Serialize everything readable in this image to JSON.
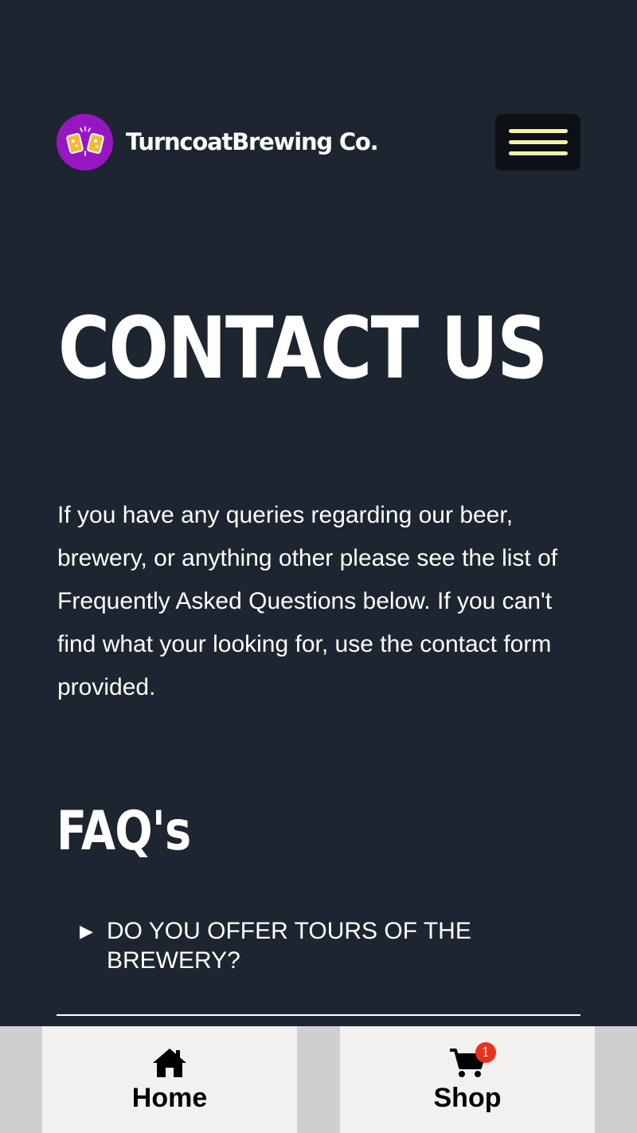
{
  "header": {
    "brand_name": "TurncoatBrewing Co.",
    "logo_icon": "cheers-beer-mugs-icon",
    "menu_icon": "hamburger-menu-icon",
    "colors": {
      "background": "#1d2530",
      "logo_bg": "#9617c2",
      "menu_bar": "#f6f0a8"
    }
  },
  "page": {
    "title": "CONTACT US",
    "intro": "If you have any queries regarding our beer, brewery, or anything other please see the list of Frequently Asked Questions below. If you can't find what your looking for, use the contact form provided."
  },
  "faq": {
    "heading": "FAQ's",
    "items": [
      {
        "arrow": "▶",
        "question": "DO YOU OFFER TOURS OF THE BREWERY?"
      }
    ]
  },
  "bottom_nav": {
    "home": {
      "label": "Home",
      "icon": "home-icon"
    },
    "shop": {
      "label": "Shop",
      "icon": "shopping-cart-icon",
      "badge": "1"
    }
  }
}
